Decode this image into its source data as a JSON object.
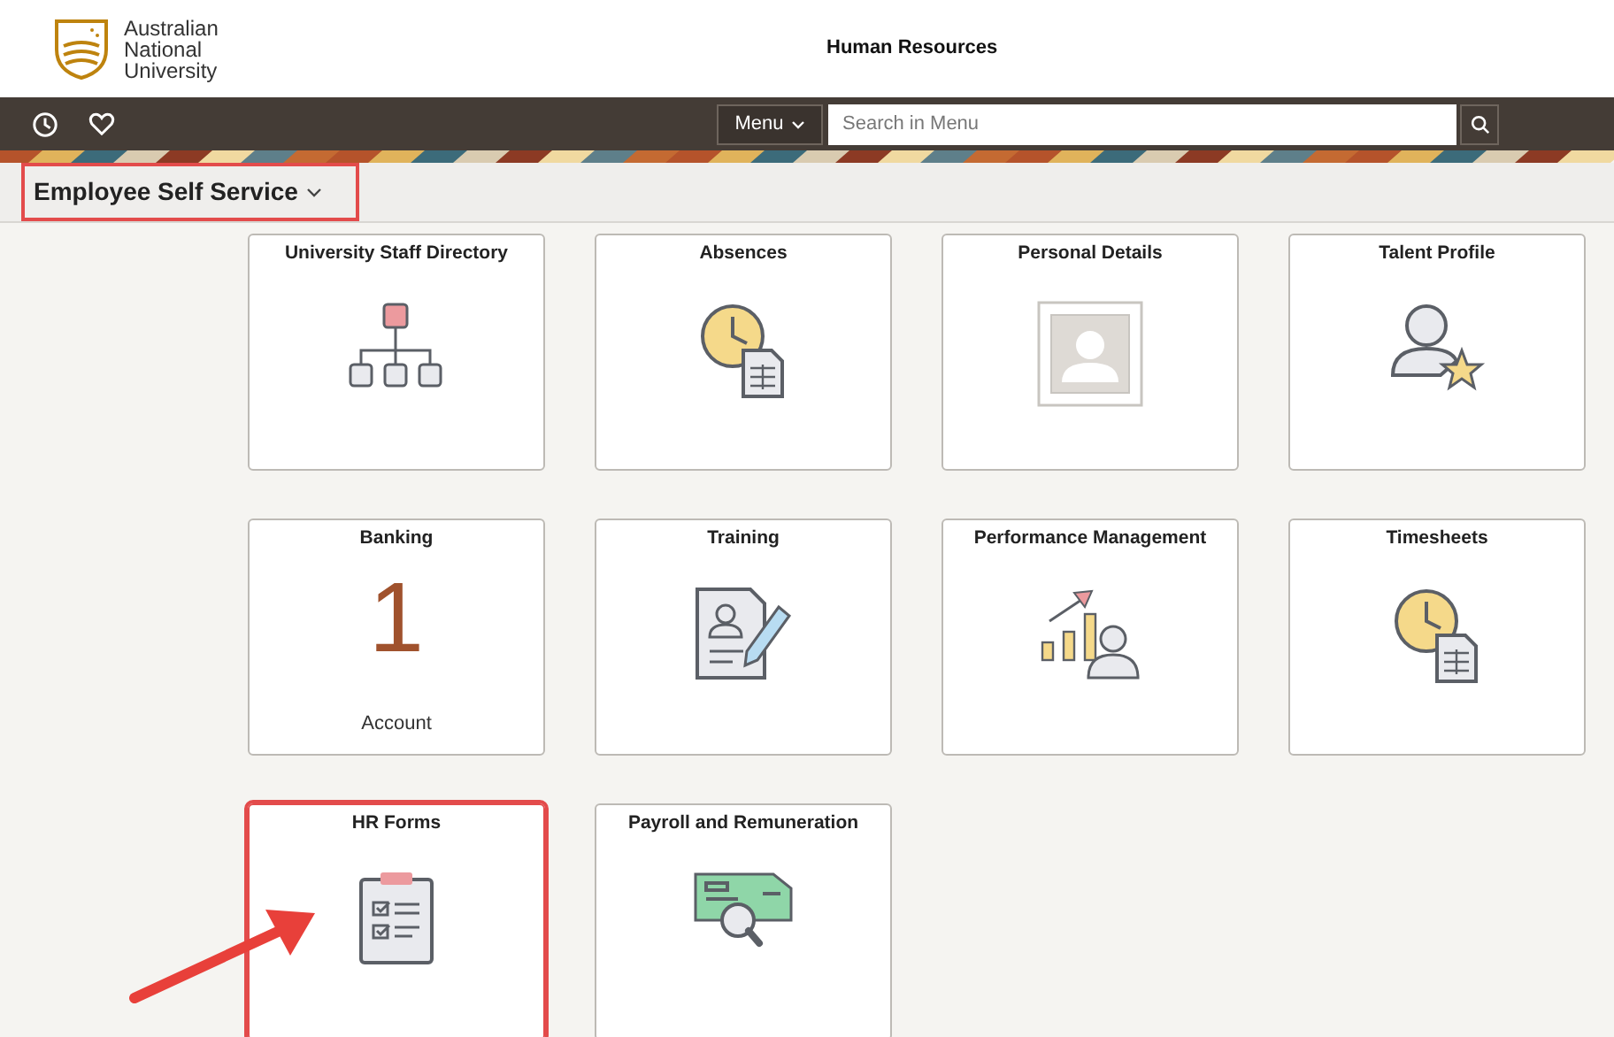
{
  "logo": {
    "lines": [
      "Australian",
      "National",
      "University"
    ]
  },
  "header": {
    "title": "Human Resources"
  },
  "nav": {
    "menu_button": "Menu",
    "search": {
      "placeholder": "Search in Menu"
    }
  },
  "homepage": {
    "title": "Employee Self Service",
    "highlighted": true
  },
  "tiles": [
    {
      "title": "University Staff Directory",
      "kind": "icon",
      "highlighted": false
    },
    {
      "title": "Absences",
      "kind": "icon",
      "highlighted": false
    },
    {
      "title": "Personal Details",
      "kind": "icon",
      "highlighted": false
    },
    {
      "title": "Talent Profile",
      "kind": "icon",
      "highlighted": false
    },
    {
      "title": "Banking",
      "kind": "count",
      "count": "1",
      "caption": "Account",
      "highlighted": false
    },
    {
      "title": "Training",
      "kind": "icon",
      "highlighted": false
    },
    {
      "title": "Performance Management",
      "kind": "icon",
      "highlighted": false
    },
    {
      "title": "Timesheets",
      "kind": "icon",
      "highlighted": false
    },
    {
      "title": "HR Forms",
      "kind": "icon",
      "highlighted": true
    },
    {
      "title": "Payroll and Remuneration",
      "kind": "icon",
      "highlighted": false
    }
  ]
}
